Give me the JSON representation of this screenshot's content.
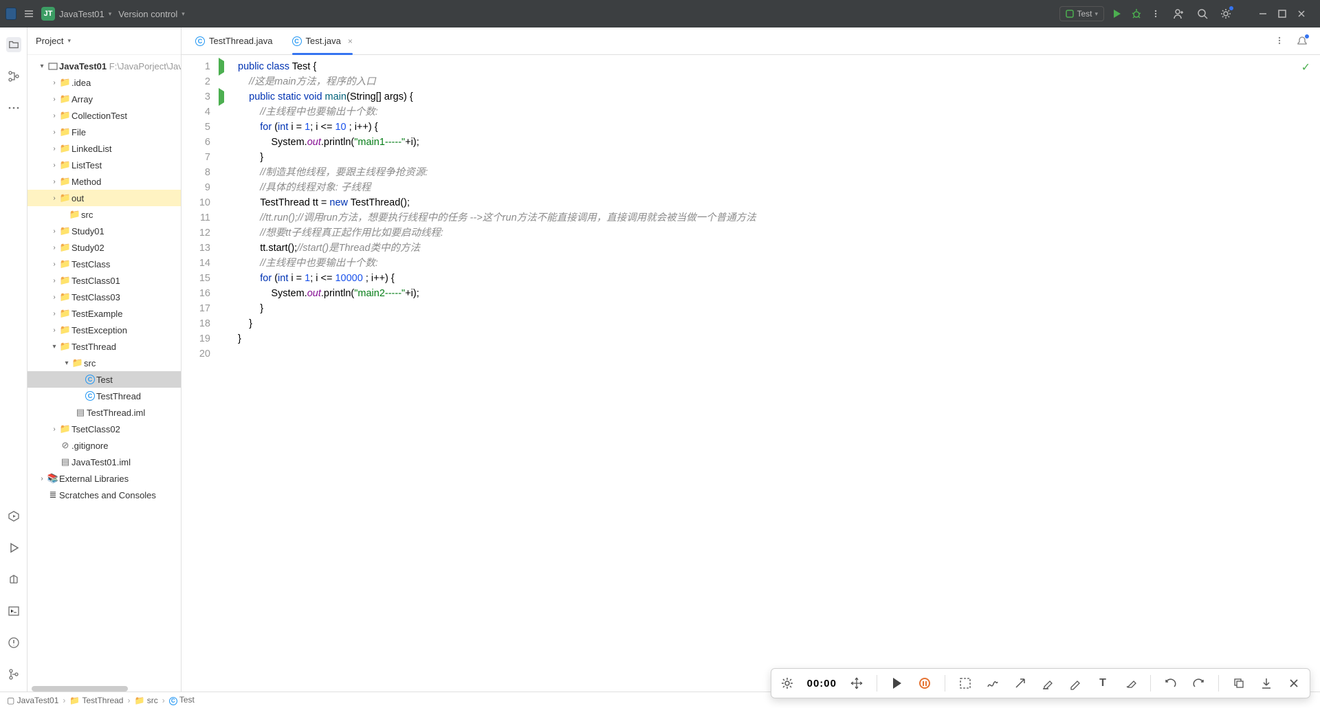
{
  "titlebar": {
    "project_name": "JavaTest01",
    "vcs_label": "Version control",
    "run_config": "Test"
  },
  "sidebar": {
    "header": "Project",
    "root": {
      "name": "JavaTest01",
      "path": "F:\\JavaPorject\\JavaTes"
    },
    "items": {
      "idea": ".idea",
      "Array": "Array",
      "CollectionTest": "CollectionTest",
      "File": "File",
      "LinkedList": "LinkedList",
      "ListTest": "ListTest",
      "Method": "Method",
      "out": "out",
      "src_root": "src",
      "Study01": "Study01",
      "Study02": "Study02",
      "TestClass": "TestClass",
      "TestClass01": "TestClass01",
      "TestClass03": "TestClass03",
      "TestExample": "TestExample",
      "TestException": "TestException",
      "TestThread": "TestThread",
      "src": "src",
      "Test": "Test",
      "TestThreadClass": "TestThread",
      "iml": "TestThread.iml",
      "TsetClass02": "TsetClass02",
      "gitignore": ".gitignore",
      "proj_iml": "JavaTest01.iml",
      "ext_lib": "External Libraries",
      "scratches": "Scratches and Consoles"
    }
  },
  "tabs": {
    "t0": "TestThread.java",
    "t1": "Test.java"
  },
  "gutter": {
    "l1": "1",
    "l2": "2",
    "l3": "3",
    "l4": "4",
    "l5": "5",
    "l6": "6",
    "l7": "7",
    "l8": "8",
    "l9": "9",
    "l10": "10",
    "l11": "11",
    "l12": "12",
    "l13": "13",
    "l14": "14",
    "l15": "15",
    "l16": "16",
    "l17": "17",
    "l18": "18",
    "l19": "19",
    "l20": "20"
  },
  "code": {
    "l1_a": "public class ",
    "l1_b": "Test {",
    "l2_a": "    //这是main方法，程序的入口",
    "l3_a": "    ",
    "l3_b": "public static void ",
    "l3_c": "main",
    "l3_d": "(String[] args) {",
    "l4_a": "        //主线程中也要输出十个数:",
    "l5_a": "        ",
    "l5_b": "for ",
    "l5_c": "(",
    "l5_d": "int ",
    "l5_e": "i = ",
    "l5_f": "1",
    "l5_g": "; i <= ",
    "l5_h": "10",
    "l5_i": " ; i++) {",
    "l6_a": "            System.",
    "l6_b": "out",
    "l6_c": ".println(",
    "l6_d": "\"main1-----\"",
    "l6_e": "+i);",
    "l7_a": "        }",
    "l8_a": "        //制造其他线程，要跟主线程争抢资源:",
    "l9_a": "        //具体的线程对象: 子线程",
    "l10_a": "        TestThread tt = ",
    "l10_b": "new ",
    "l10_c": "TestThread();",
    "l11_a": "        //tt.run();//调用run方法，想要执行线程中的任务 -->这个run方法不能直接调用，直接调用就会被当做一个普通方法",
    "l12_a": "        //想要tt子线程真正起作用比如要启动线程:",
    "l13_a": "        tt.start();",
    "l13_b": "//start()是Thread类中的方法",
    "l14_a": "        //主线程中也要输出十个数:",
    "l15_a": "        ",
    "l15_b": "for ",
    "l15_c": "(",
    "l15_d": "int ",
    "l15_e": "i = ",
    "l15_f": "1",
    "l15_g": "; i <= ",
    "l15_h": "10000",
    "l15_i": " ; i++) {",
    "l16_a": "            System.",
    "l16_b": "out",
    "l16_c": ".println(",
    "l16_d": "\"main2-----\"",
    "l16_e": "+i);",
    "l17_a": "        }",
    "l18_a": "    }",
    "l19_a": "}",
    "l20_a": ""
  },
  "breadcrumb": {
    "b0": "JavaTest01",
    "b1": "TestThread",
    "b2": "src",
    "b3": "Test"
  },
  "recbar": {
    "time": "00:00"
  }
}
